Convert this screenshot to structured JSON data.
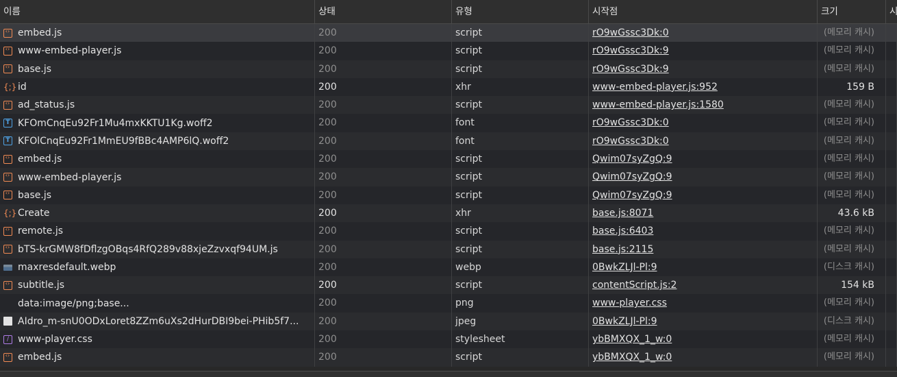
{
  "columns": {
    "name": "이름",
    "status": "상태",
    "type": "유형",
    "initiator": "시작점",
    "size": "크기",
    "extra": "시"
  },
  "rows": [
    {
      "name": "embed.js",
      "icon": "script",
      "status": "200",
      "type": "script",
      "initiator": "rO9wGssc3Dk:0",
      "size": "(메모리 캐시)",
      "cached": true
    },
    {
      "name": "www-embed-player.js",
      "icon": "script",
      "status": "200",
      "type": "script",
      "initiator": "rO9wGssc3Dk:9",
      "size": "(메모리 캐시)",
      "cached": true
    },
    {
      "name": "base.js",
      "icon": "script",
      "status": "200",
      "type": "script",
      "initiator": "rO9wGssc3Dk:9",
      "size": "(메모리 캐시)",
      "cached": true
    },
    {
      "name": "id",
      "icon": "xhr",
      "status": "200",
      "type": "xhr",
      "initiator": "www-embed-player.js:952",
      "size": "159 B",
      "cached": false
    },
    {
      "name": "ad_status.js",
      "icon": "script",
      "status": "200",
      "type": "script",
      "initiator": "www-embed-player.js:1580",
      "size": "(메모리 캐시)",
      "cached": true
    },
    {
      "name": "KFOmCnqEu92Fr1Mu4mxKKTU1Kg.woff2",
      "icon": "font",
      "status": "200",
      "type": "font",
      "initiator": "rO9wGssc3Dk:0",
      "size": "(메모리 캐시)",
      "cached": true
    },
    {
      "name": "KFOlCnqEu92Fr1MmEU9fBBc4AMP6lQ.woff2",
      "icon": "font",
      "status": "200",
      "type": "font",
      "initiator": "rO9wGssc3Dk:0",
      "size": "(메모리 캐시)",
      "cached": true
    },
    {
      "name": "embed.js",
      "icon": "script",
      "status": "200",
      "type": "script",
      "initiator": "Qwim07syZgQ:9",
      "size": "(메모리 캐시)",
      "cached": true
    },
    {
      "name": "www-embed-player.js",
      "icon": "script",
      "status": "200",
      "type": "script",
      "initiator": "Qwim07syZgQ:9",
      "size": "(메모리 캐시)",
      "cached": true
    },
    {
      "name": "base.js",
      "icon": "script",
      "status": "200",
      "type": "script",
      "initiator": "Qwim07syZgQ:9",
      "size": "(메모리 캐시)",
      "cached": true
    },
    {
      "name": "Create",
      "icon": "xhr",
      "status": "200",
      "type": "xhr",
      "initiator": "base.js:8071",
      "size": "43.6 kB",
      "cached": false
    },
    {
      "name": "remote.js",
      "icon": "script",
      "status": "200",
      "type": "script",
      "initiator": "base.js:6403",
      "size": "(메모리 캐시)",
      "cached": true
    },
    {
      "name": "bTS-krGMW8fDflzgOBqs4RfQ289v88xjeZzvxqf94UM.js",
      "icon": "script",
      "status": "200",
      "type": "script",
      "initiator": "base.js:2115",
      "size": "(메모리 캐시)",
      "cached": true
    },
    {
      "name": "maxresdefault.webp",
      "icon": "image",
      "status": "200",
      "type": "webp",
      "initiator": "0BwkZLJl-Pl:9",
      "size": "(디스크 캐시)",
      "cached": true
    },
    {
      "name": "subtitle.js",
      "icon": "script",
      "status": "200",
      "type": "script",
      "initiator": "contentScript.js:2",
      "size": "154 kB",
      "cached": false
    },
    {
      "name": "data:image/png;base...",
      "icon": "png",
      "status": "200",
      "type": "png",
      "initiator": "www-player.css",
      "size": "(메모리 캐시)",
      "cached": true
    },
    {
      "name": "AIdro_m-snU0ODxLoret8ZZm6uXs2dHurDBI9bei-PHib5f7...",
      "icon": "jpeg",
      "status": "200",
      "type": "jpeg",
      "initiator": "0BwkZLJl-Pl:9",
      "size": "(디스크 캐시)",
      "cached": true
    },
    {
      "name": "www-player.css",
      "icon": "css",
      "status": "200",
      "type": "stylesheet",
      "initiator": "ybBMXQX_1_w:0",
      "size": "(메모리 캐시)",
      "cached": true
    },
    {
      "name": "embed.js",
      "icon": "script",
      "status": "200",
      "type": "script",
      "initiator": "ybBMXQX_1_w:0",
      "size": "(메모리 캐시)",
      "cached": true
    }
  ],
  "colors": {
    "background": "#282828",
    "script_icon": "#f28b54",
    "font_icon": "#4fa3e6",
    "css_icon": "#b07ce8",
    "cached_text": "#8f8f8f"
  }
}
